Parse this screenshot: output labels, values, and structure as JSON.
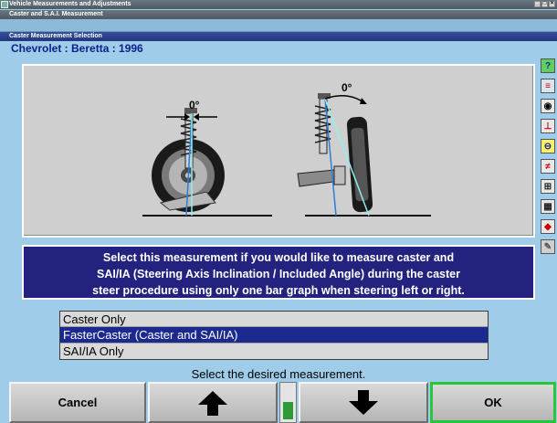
{
  "window": {
    "title": "Vehicle Measurements and Adjustments",
    "subtitle": "Caster and S.A.I. Measurement",
    "dialog_title": "Caster Measurement Selection"
  },
  "vehicle": {
    "label": "Chevrolet : Beretta : 1996"
  },
  "diagram": {
    "left_angle_label": "0°",
    "right_angle_label": "0°"
  },
  "description": {
    "line1": "Select this measurement if you would like to measure caster and",
    "line2": "SAI/IA (Steering Axis Inclination / Included Angle) during the caster",
    "line3": "steer procedure using only one bar graph when steering left or right."
  },
  "options": [
    {
      "label": "Caster Only",
      "selected": false
    },
    {
      "label": "FasterCaster (Caster and SAI/IA)",
      "selected": true
    },
    {
      "label": "SAI/IA Only",
      "selected": false
    }
  ],
  "prompt": "Select the desired measurement.",
  "buttons": {
    "cancel": "Cancel",
    "ok": "OK",
    "up_icon": "up-arrow",
    "down_icon": "down-arrow"
  },
  "scroll_indicator": {
    "fill_fraction": 0.45
  },
  "colors": {
    "background": "#9fcce8",
    "banner": "#23237f",
    "selection": "#1c2a8f",
    "ok_border": "#27c63b",
    "title": "#0b1e8c"
  },
  "sidebar_icons": [
    "help-icon",
    "gauge-icon",
    "target-icon",
    "alignment-icon",
    "steering-icon",
    "camber-icon",
    "caster-icon",
    "measure-icon",
    "print-icon",
    "tool-icon"
  ]
}
